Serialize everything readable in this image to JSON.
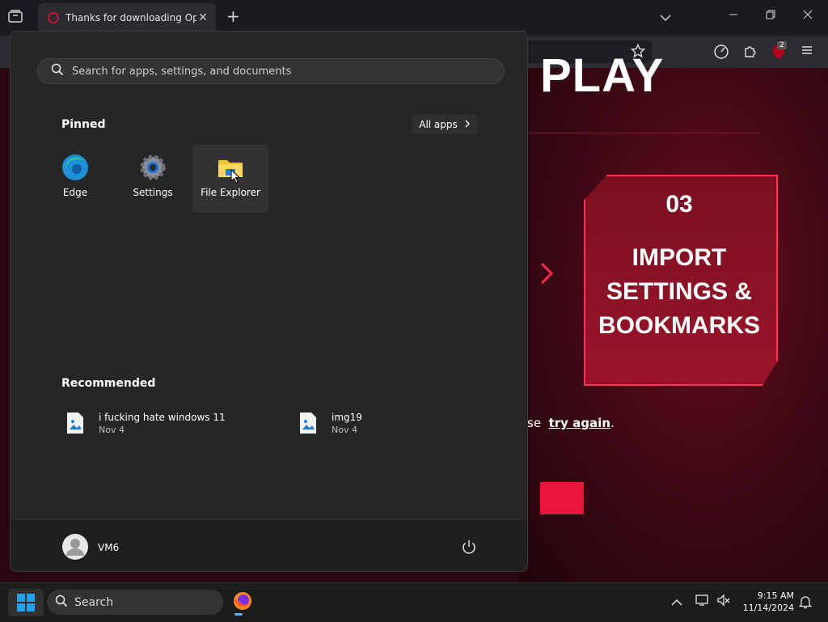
{
  "browser": {
    "tab_title": "Thanks for downloading Opera",
    "tab_close": "✕",
    "new_tab": "+",
    "extension_badge": "2"
  },
  "page": {
    "headline": "PLAY",
    "step_number": "03",
    "step_text": "IMPORT SETTINGS & BOOKMARKS",
    "retry_prefix": "se",
    "retry_link": "try again",
    "retry_suffix": "."
  },
  "start_menu": {
    "search_placeholder": "Search for apps, settings, and documents",
    "pinned_title": "Pinned",
    "all_apps_label": "All apps",
    "pinned": [
      {
        "label": "Edge",
        "icon": "edge-icon"
      },
      {
        "label": "Settings",
        "icon": "settings-gear-icon"
      },
      {
        "label": "File Explorer",
        "icon": "folder-icon"
      }
    ],
    "recommended_title": "Recommended",
    "recommended": [
      {
        "name": "i fucking hate windows 11",
        "date": "Nov 4"
      },
      {
        "name": "img19",
        "date": "Nov 4"
      }
    ],
    "user_name": "VM6"
  },
  "taskbar": {
    "search_label": "Search",
    "time": "9:15 AM",
    "date": "11/14/2024"
  },
  "colors": {
    "accent_red": "#e8163d",
    "start_bg": "#262626",
    "windows_blue": "#1fa3ef"
  }
}
